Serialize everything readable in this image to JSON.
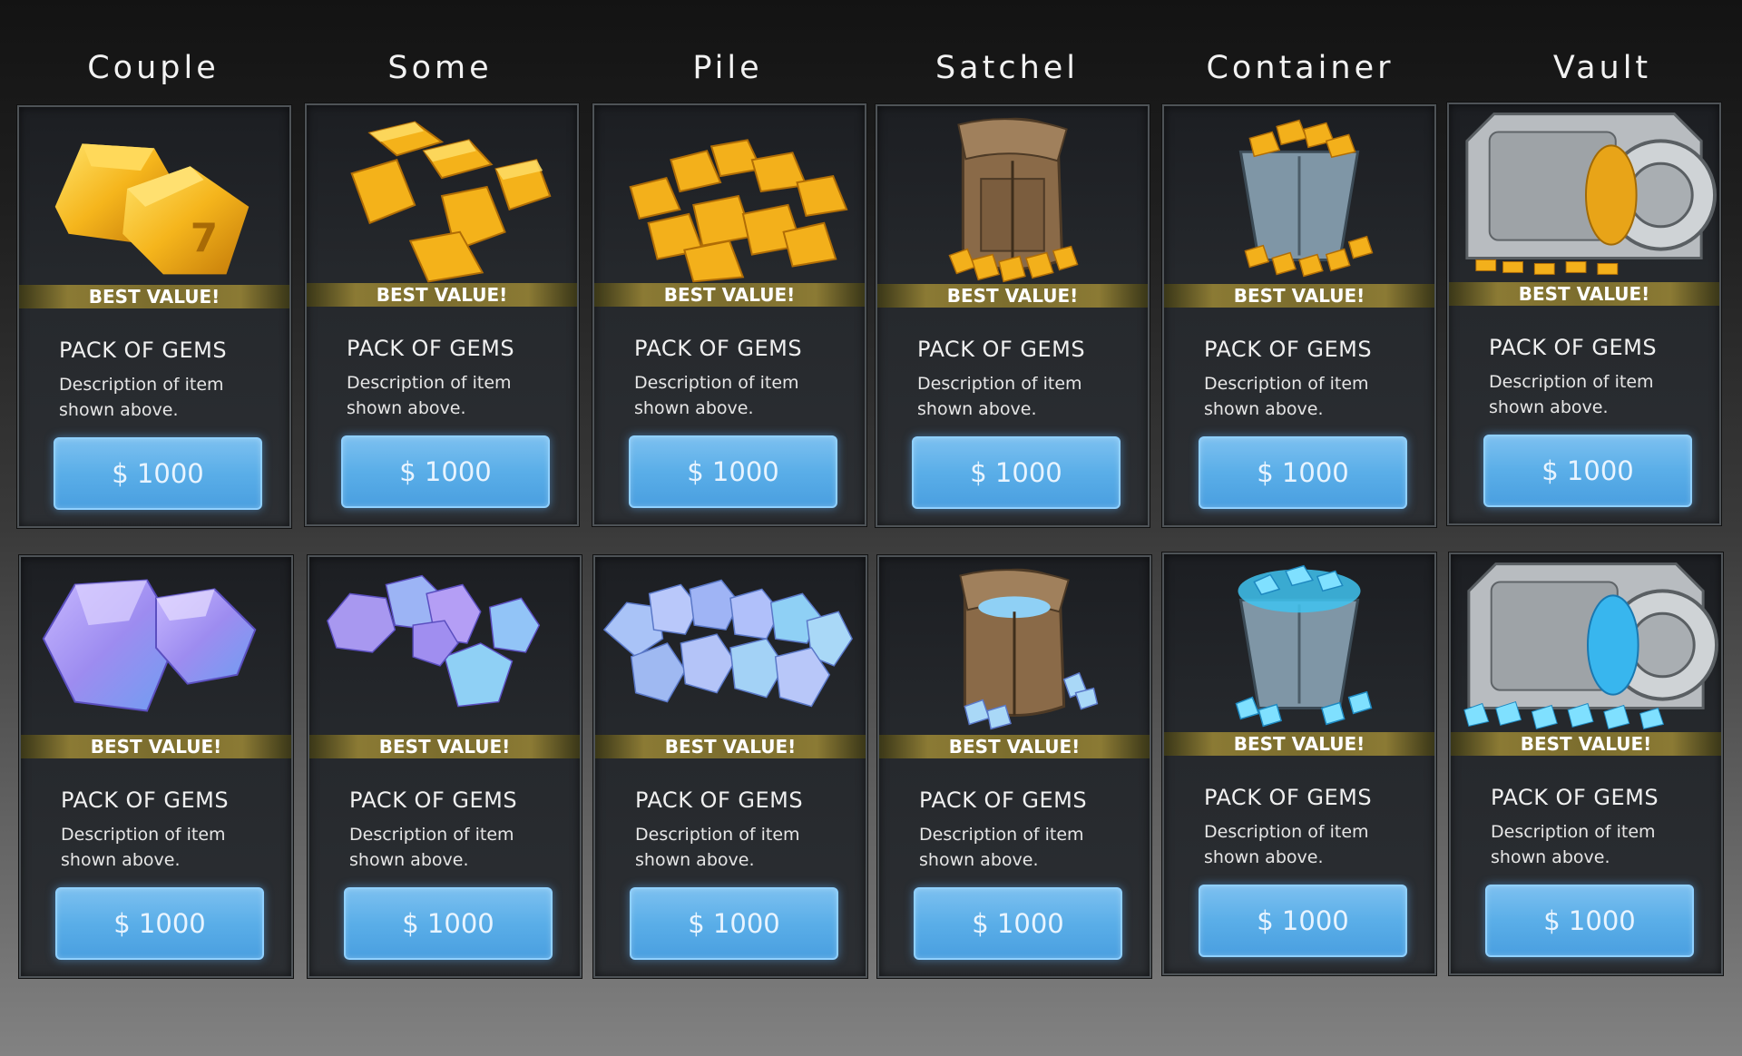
{
  "columns": [
    "Couple",
    "Some",
    "Pile",
    "Satchel",
    "Container",
    "Vault"
  ],
  "card": {
    "badge": "BEST VALUE!",
    "title": "PACK OF GEMS",
    "description": "Description of item shown above.",
    "price": "$ 1000"
  },
  "rows": [
    {
      "row": "gold",
      "items": [
        {
          "art": "gold-bars-couple-icon"
        },
        {
          "art": "gold-bars-some-icon"
        },
        {
          "art": "gold-bars-pile-icon"
        },
        {
          "art": "gold-satchel-icon"
        },
        {
          "art": "gold-container-icon"
        },
        {
          "art": "gold-vault-icon"
        }
      ]
    },
    {
      "row": "crystal",
      "items": [
        {
          "art": "crystal-couple-icon"
        },
        {
          "art": "crystal-some-icon"
        },
        {
          "art": "crystal-pile-icon"
        },
        {
          "art": "crystal-satchel-icon"
        },
        {
          "art": "crystal-container-icon"
        },
        {
          "art": "crystal-vault-icon"
        }
      ]
    }
  ],
  "colors": {
    "gold": "#f2a914",
    "crystal": "#9fb9f2",
    "button": "#5aaee8",
    "badge": "#7b6d2e"
  }
}
